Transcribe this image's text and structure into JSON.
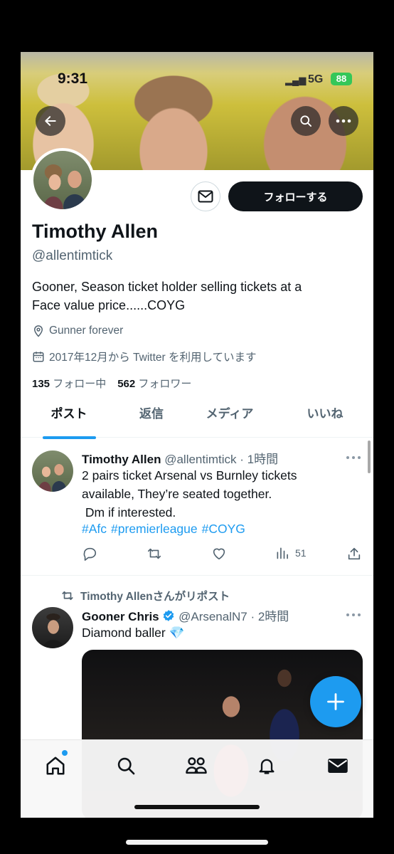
{
  "status_bar": {
    "time": "9:31",
    "network": "5G",
    "battery": "88"
  },
  "profile": {
    "name": "Timothy Allen",
    "handle": "@allentimtick",
    "bio_line1": "Gooner, Season ticket holder selling tickets at a",
    "bio_line2": "Face value price......COYG",
    "location": "Gunner forever",
    "joined": "2017年12月から Twitter を利用しています",
    "following_count": "135",
    "following_label": "フォロー中",
    "followers_count": "562",
    "followers_label": "フォロワー",
    "follow_button": "フォローする"
  },
  "tabs": [
    "ポスト",
    "返信",
    "メディア",
    "いいね"
  ],
  "tweets": [
    {
      "author": "Timothy Allen",
      "meta": "@allentimtick · 1時間",
      "lines": [
        "2 pairs ticket Arsenal vs Burnley tickets",
        "available, They’re seated together.",
        " Dm if interested."
      ],
      "hashtags": [
        "#Afc",
        "#premierleague",
        "#COYG"
      ],
      "views": "51"
    },
    {
      "repost_by": "Timothy Allenさんがリポスト",
      "author": "Gooner Chris",
      "meta": "@ArsenalN7 · 2時間",
      "text": "Diamond baller 💎"
    }
  ],
  "colors": {
    "accent": "#1d9bf0",
    "text": "#0f1419",
    "muted": "#536471"
  },
  "icons": {
    "back": "back-arrow-icon",
    "search": "search-icon",
    "more": "more-icon",
    "mail": "mail-icon",
    "location": "location-pin-icon",
    "calendar": "calendar-icon",
    "reply": "reply-icon",
    "retweet": "retweet-icon",
    "like": "heart-icon",
    "views": "views-icon",
    "share": "share-icon",
    "compose": "plus-icon",
    "home": "home-icon",
    "explore": "search-icon",
    "communities": "people-icon",
    "notifications": "bell-icon",
    "messages": "envelope-icon"
  }
}
